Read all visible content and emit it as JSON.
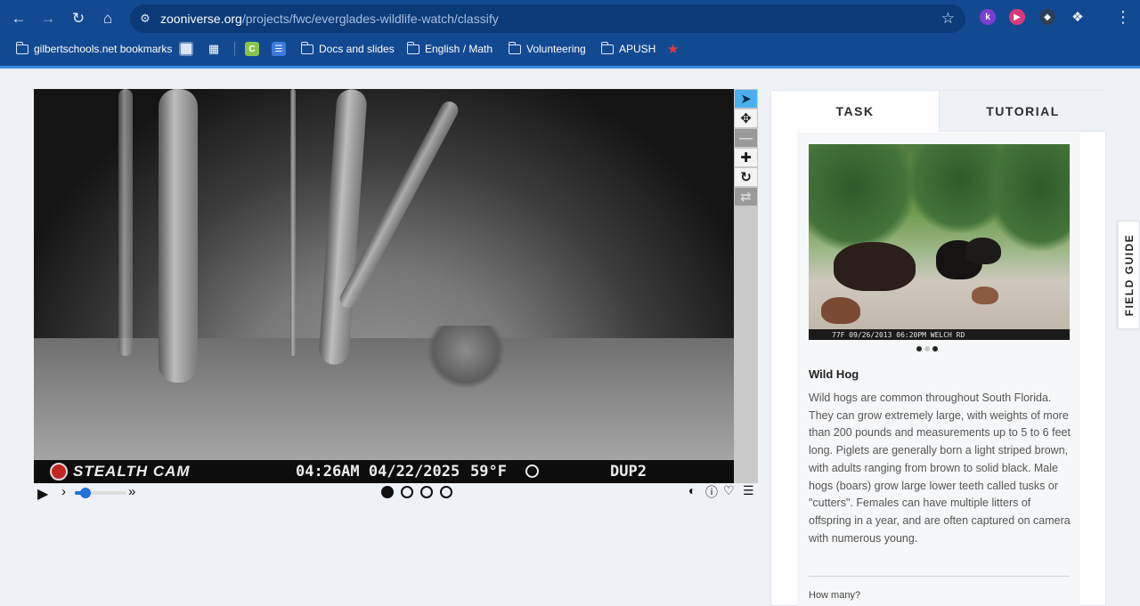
{
  "browser": {
    "url_domain": "zooniverse.org",
    "url_path": "/projects/fwc/everglades-wildlife-watch/classify",
    "bookmarks": [
      {
        "label": "gilbertschools.net bookmarks",
        "icon": "managed-folder-icon"
      },
      {
        "label": "",
        "icon": "app-icon"
      },
      {
        "label": "",
        "icon": "apps-grid-icon"
      },
      {
        "label": "",
        "icon": "c-app-icon"
      },
      {
        "label": "",
        "icon": "striped-app-icon"
      },
      {
        "label": "Docs and slides",
        "icon": "folder-icon"
      },
      {
        "label": "English / Math",
        "icon": "folder-icon"
      },
      {
        "label": "Volunteering",
        "icon": "folder-icon"
      },
      {
        "label": "APUSH",
        "icon": "folder-icon"
      },
      {
        "label": "",
        "icon": "star-flag-icon"
      }
    ],
    "colors": {
      "chrome": "#124a92",
      "omnibox": "#0b3a78",
      "accent_line": "#3b8ae0"
    }
  },
  "subject": {
    "camera_brand": "STEALTH CAM",
    "camera_time": "04:26AM 04/22/2025",
    "camera_temp": "59°F",
    "camera_id": "DUP2",
    "frames_total": 4,
    "current_frame": 1
  },
  "tools": [
    "pointer-icon",
    "move-icon",
    "zoom-out-icon",
    "zoom-in-icon",
    "rotate-icon",
    "reset-icon"
  ],
  "panel": {
    "tabs": {
      "task": "TASK",
      "tutorial": "TUTORIAL"
    },
    "field_guide": "FIELD GUIDE",
    "example_caption": "77F  09/26/2013 06:20PM WELCH RD",
    "animal_name": "Wild Hog",
    "animal_description": "Wild hogs are common throughout South Florida. They can grow extremely large, with weights of more than 200 pounds and measurements up to 5 to 6 feet long. Piglets are generally born a light striped brown, with adults ranging from brown to solid black. Male hogs (boars) grow large lower teeth called tusks or \"cutters\". Females can have multiple litters of offspring in a year, and are often captured on camera with numerous young.",
    "question": "How many?"
  }
}
